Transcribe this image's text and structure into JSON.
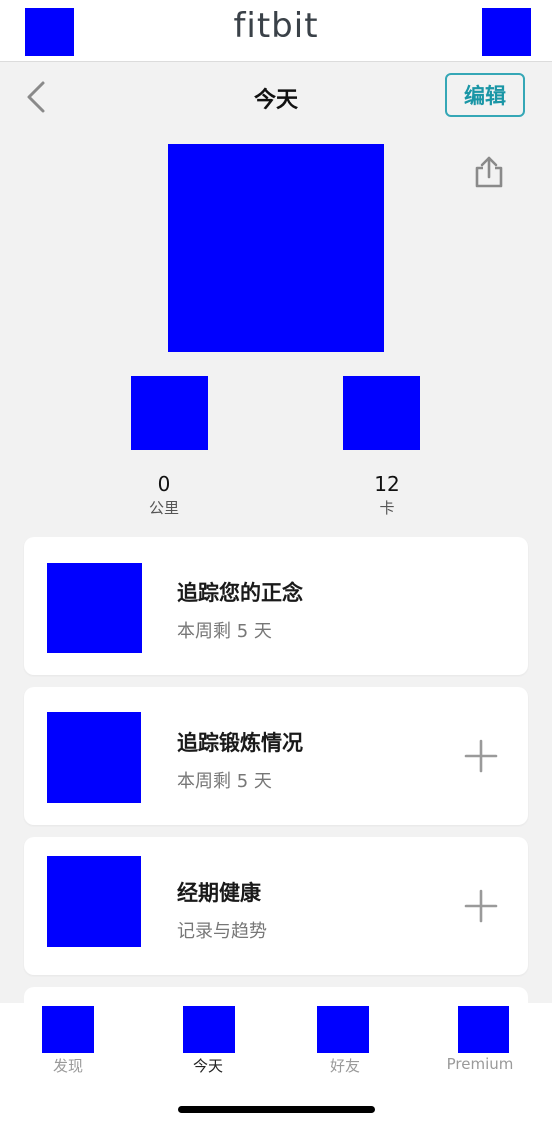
{
  "header": {
    "logo": "fitbit"
  },
  "nav": {
    "title": "今天",
    "edit_label": "编辑"
  },
  "stats": [
    {
      "value": "0",
      "unit": "公里"
    },
    {
      "value": "12",
      "unit": "卡"
    }
  ],
  "cards": [
    {
      "title": "追踪您的正念",
      "subtitle": "本周剩 5 天",
      "has_plus": false
    },
    {
      "title": "追踪锻炼情况",
      "subtitle": "本周剩 5 天",
      "has_plus": true
    },
    {
      "title": "经期健康",
      "subtitle": "记录与趋势",
      "has_plus": true
    }
  ],
  "tabs": [
    {
      "label": "发现",
      "active": false
    },
    {
      "label": "今天",
      "active": true
    },
    {
      "label": "好友",
      "active": false
    },
    {
      "label": "Premium",
      "active": false
    }
  ],
  "colors": {
    "accent": "#1a96a6",
    "placeholder": "#0000ff"
  }
}
